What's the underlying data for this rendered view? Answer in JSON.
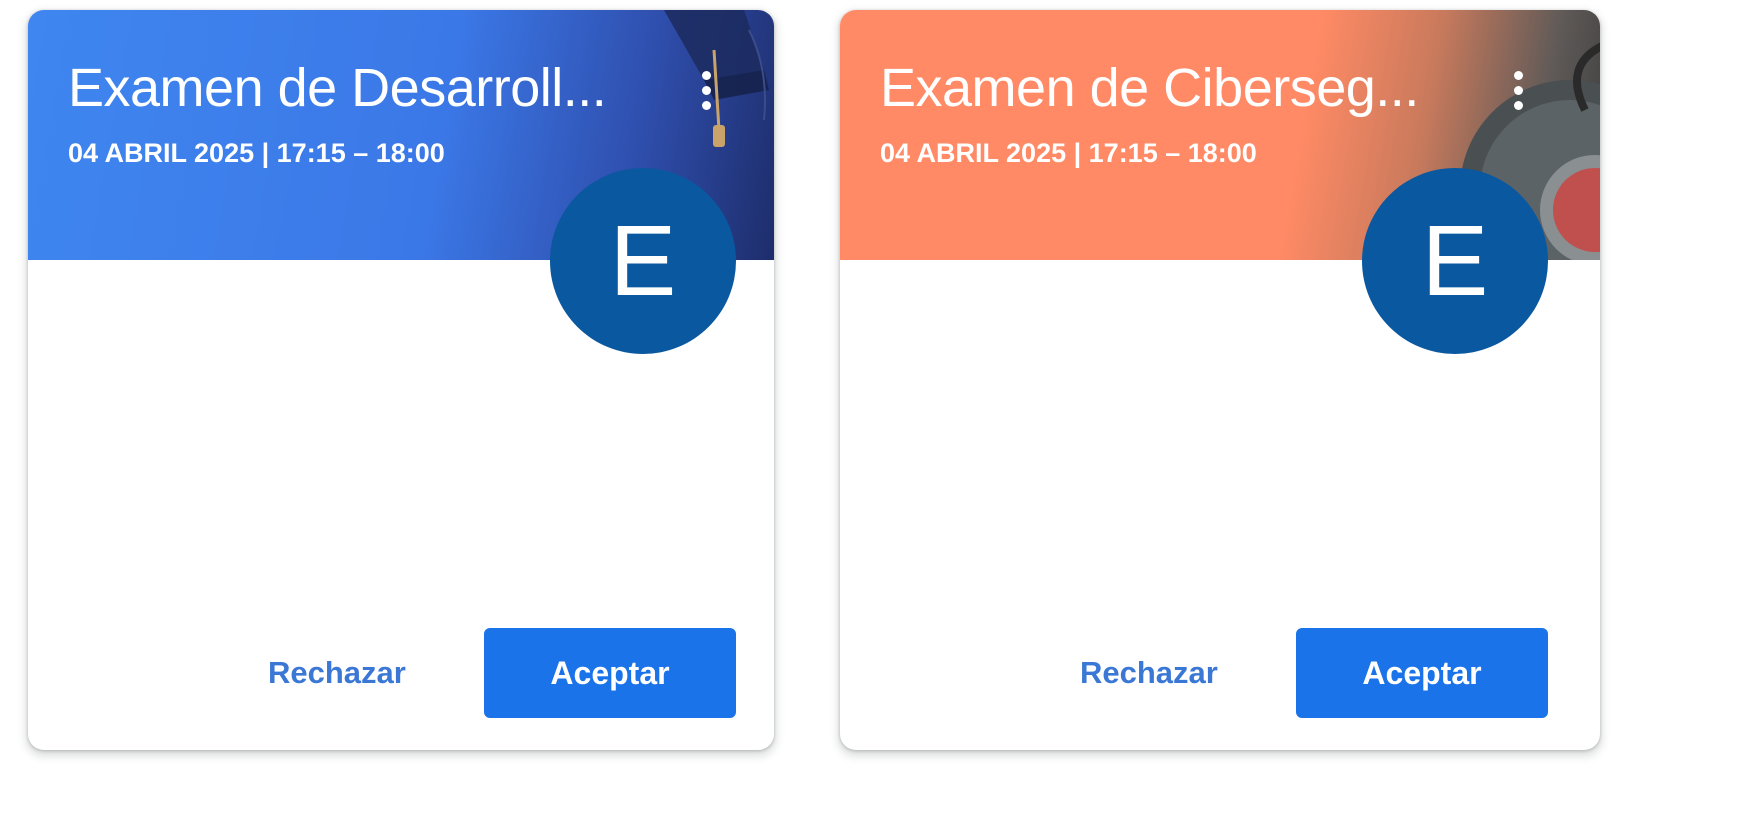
{
  "cards": [
    {
      "title": "Examen de Desarroll...",
      "schedule": "04 ABRIL 2025 | 17:15 – 18:00",
      "avatar_letter": "E",
      "reject_label": "Rechazar",
      "accept_label": "Aceptar",
      "banner_color": "#3b78e7",
      "banner_illustration": "graduation-cap-icon"
    },
    {
      "title": "Examen de Ciberseg...",
      "schedule": "04 ABRIL 2025 | 17:15 – 18:00",
      "avatar_letter": "E",
      "reject_label": "Rechazar",
      "accept_label": "Aceptar",
      "banner_color": "#ff8a65",
      "banner_illustration": "lock-dial-icon"
    }
  ],
  "colors": {
    "avatar": "#0a58a0",
    "accept_button": "#1a73e8",
    "reject_text": "#3b78d6"
  }
}
